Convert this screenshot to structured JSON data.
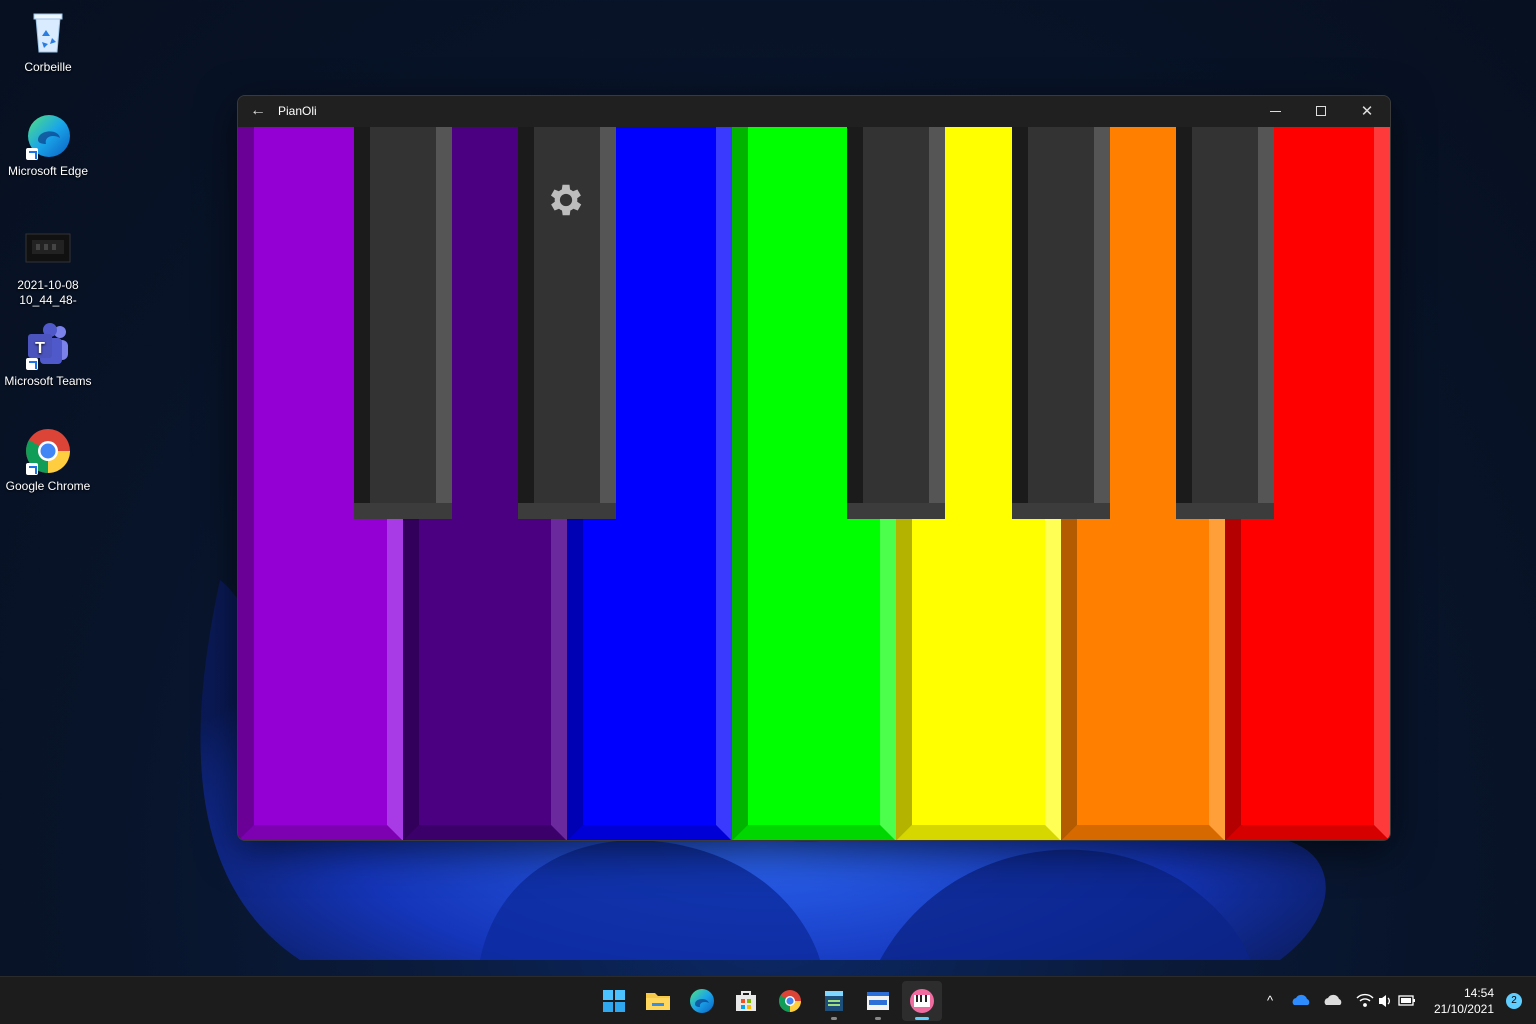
{
  "desktop": {
    "icons": [
      {
        "label": "Corbeille",
        "icon": "recycle-bin-icon"
      },
      {
        "label": "Microsoft Edge",
        "icon": "edge-icon"
      },
      {
        "label": "2021-10-08\n10_44_48-",
        "icon": "image-file-icon"
      },
      {
        "label": "Microsoft Teams",
        "icon": "teams-icon"
      },
      {
        "label": "Google Chrome",
        "icon": "chrome-icon"
      }
    ]
  },
  "window": {
    "title": "PianOli",
    "back_glyph": "←",
    "close_glyph": "✕",
    "settings_icon": "gear-icon",
    "white_keys": [
      {
        "color": "#9400D3",
        "light": "#A83BE6",
        "dark": "#6A0096"
      },
      {
        "color": "#4B0082",
        "light": "#6A2A9E",
        "dark": "#32005A"
      },
      {
        "color": "#0000FF",
        "light": "#3A3AFF",
        "dark": "#0000B4"
      },
      {
        "color": "#00FF00",
        "light": "#4DFF4D",
        "dark": "#00B400"
      },
      {
        "color": "#FFFF00",
        "light": "#FFFF55",
        "dark": "#B4B400"
      },
      {
        "color": "#FF7F00",
        "light": "#FF9F3A",
        "dark": "#B45A00"
      },
      {
        "color": "#FF0000",
        "light": "#FF3A3A",
        "dark": "#B40000"
      }
    ],
    "black_key_count": 5
  },
  "taskbar": {
    "apps": [
      {
        "name": "start-button",
        "icon": "windows-start-icon"
      },
      {
        "name": "file-explorer",
        "icon": "folder-icon"
      },
      {
        "name": "edge",
        "icon": "edge-icon"
      },
      {
        "name": "microsoft-store",
        "icon": "store-icon"
      },
      {
        "name": "chrome",
        "icon": "chrome-icon"
      },
      {
        "name": "app-1",
        "icon": "app-window-icon"
      },
      {
        "name": "app-2",
        "icon": "app-window-icon"
      },
      {
        "name": "pianoli",
        "icon": "piano-icon"
      }
    ],
    "tray": {
      "chevron": "^",
      "time": "14:54",
      "date": "21/10/2021",
      "notifications": "2"
    }
  }
}
